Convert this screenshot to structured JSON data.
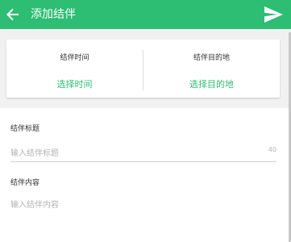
{
  "toolbar": {
    "title": "添加结伴",
    "back_icon": "arrow-left-icon",
    "send_icon": "send-icon",
    "color": "#2dbd73"
  },
  "selectors": {
    "time": {
      "label": "结伴时间",
      "value": "选择时间"
    },
    "destination": {
      "label": "结伴目的地",
      "value": "选择目的地"
    }
  },
  "form": {
    "title_label": "结伴标题",
    "title_placeholder": "输入结伴标题",
    "title_max_length": "40",
    "content_label": "结伴内容",
    "content_placeholder": "输入结伴内容"
  },
  "colors": {
    "accent": "#2dbd73",
    "background": "#f1f1f1",
    "text": "#333333",
    "hint": "#b4b4b4"
  }
}
